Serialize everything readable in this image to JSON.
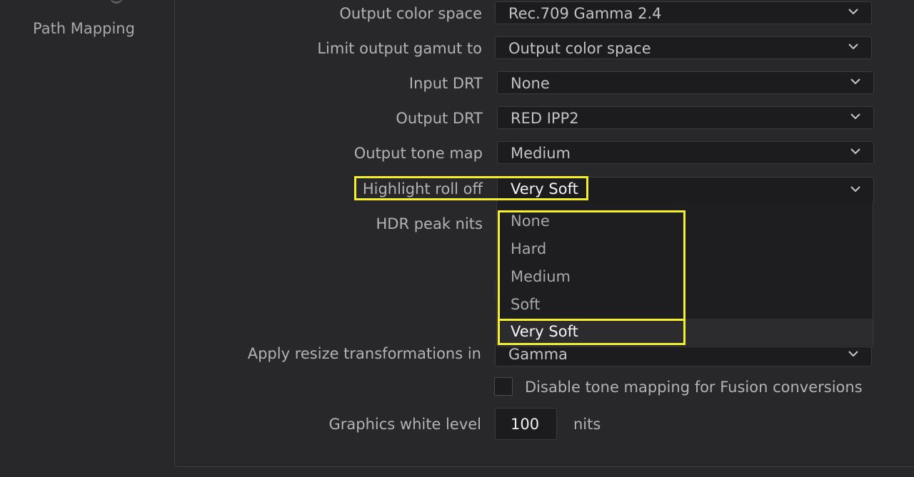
{
  "sidebar": {
    "items": [
      {
        "label": "Path Mapping"
      }
    ]
  },
  "fields": {
    "output_color_space": {
      "label": "Output color space",
      "value": "Rec.709 Gamma 2.4"
    },
    "limit_output_gamut": {
      "label": "Limit output gamut to",
      "value": "Output color space"
    },
    "input_drt": {
      "label": "Input DRT",
      "value": "None"
    },
    "output_drt": {
      "label": "Output DRT",
      "value": "RED IPP2"
    },
    "output_tone_map": {
      "label": "Output tone map",
      "value": "Medium"
    },
    "highlight_roll_off": {
      "label": "Highlight roll off",
      "value": "Very Soft"
    },
    "hdr_peak_nits": {
      "label": "HDR peak nits"
    },
    "apply_resize": {
      "label": "Apply resize transformations in",
      "value": "Gamma"
    }
  },
  "dropdown": {
    "options": [
      "None",
      "Hard",
      "Medium",
      "Soft",
      "Very Soft"
    ],
    "selected": "Very Soft"
  },
  "disable_tone_mapping": {
    "label": "Disable tone mapping for Fusion conversions",
    "checked": false
  },
  "graphics_white_level": {
    "label": "Graphics white level",
    "value": "100",
    "unit": "nits"
  },
  "colors": {
    "background": "#28282a",
    "field_bg": "#1c1c1e",
    "highlight": "#f3ef2a"
  }
}
